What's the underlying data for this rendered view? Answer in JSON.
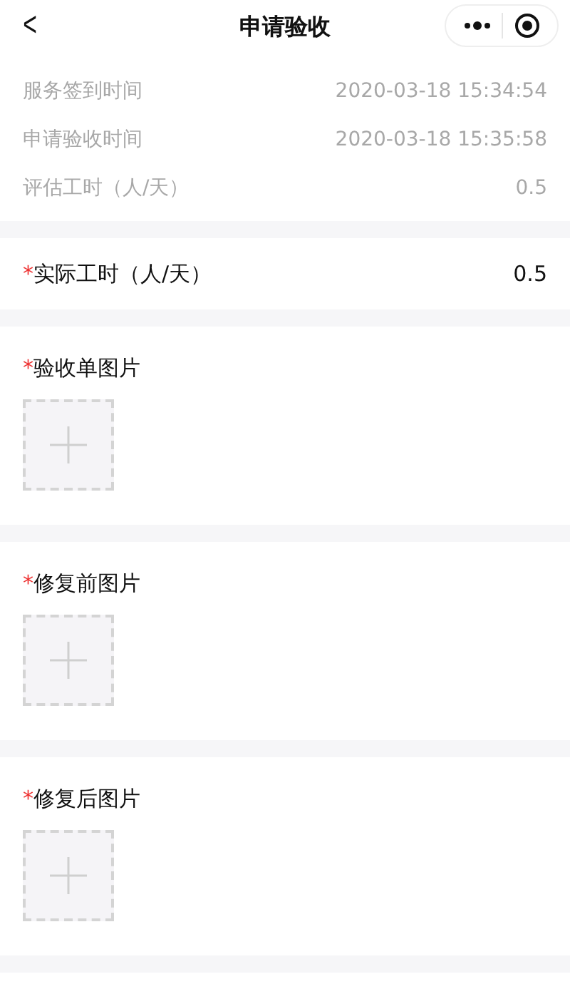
{
  "nav": {
    "back": "<",
    "title": "申请验收"
  },
  "info_rows": [
    {
      "label": "服务签到时间",
      "value": "2020-03-18  15:34:54"
    },
    {
      "label": "申请验收时间",
      "value": "2020-03-18  15:35:58"
    },
    {
      "label": "评估工时（人/天）",
      "value": "0.5"
    }
  ],
  "actual_hours": {
    "required_mark": "*",
    "label": "实际工时（人/天）",
    "value": "0.5"
  },
  "photo_sections": [
    {
      "required_mark": "*",
      "label": "验收单图片"
    },
    {
      "required_mark": "*",
      "label": "修复前图片"
    },
    {
      "required_mark": "*",
      "label": "修复后图片"
    }
  ]
}
